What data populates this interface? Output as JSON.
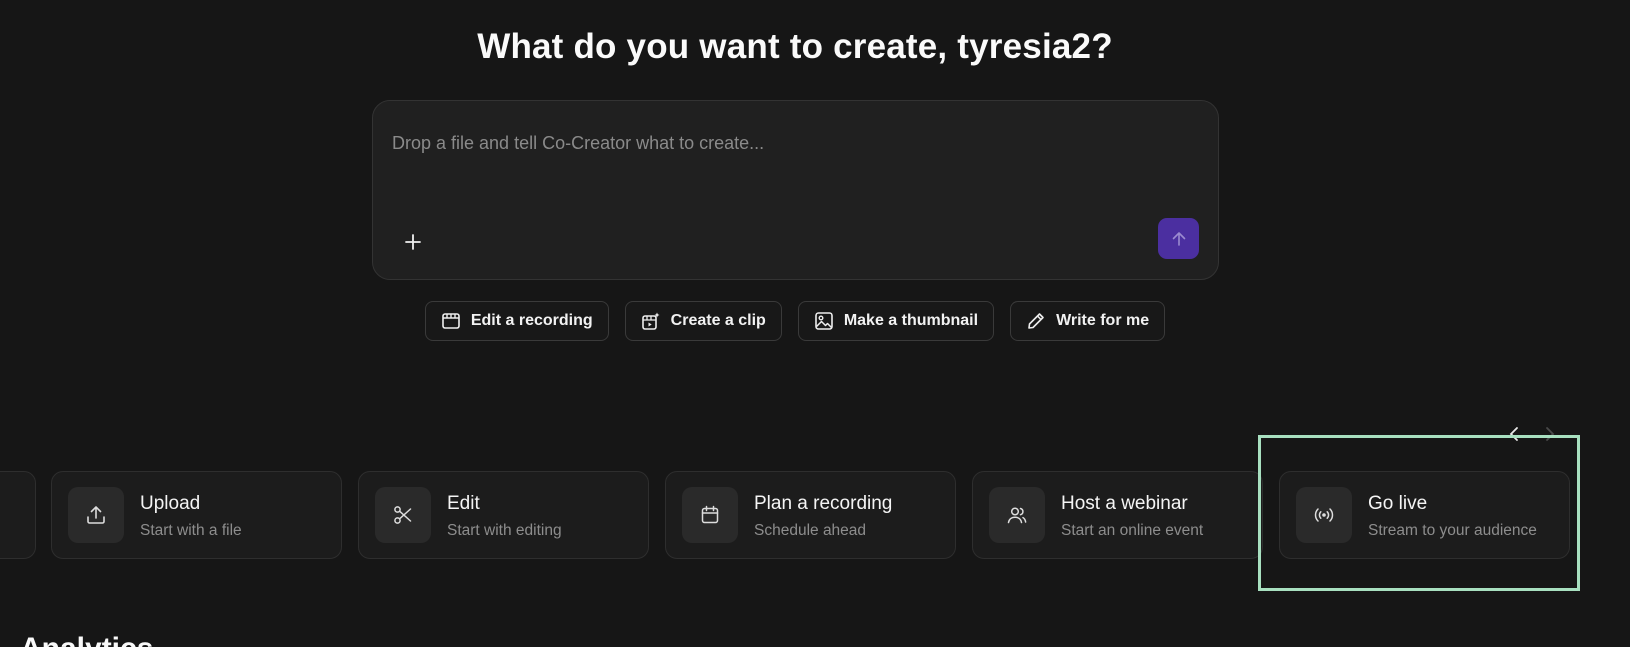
{
  "hero": {
    "title": "What do you want to create, tyresia2?"
  },
  "composer": {
    "placeholder": "Drop a file and tell Co-Creator what to create...",
    "value": ""
  },
  "quick_actions": [
    {
      "label": "Edit a recording",
      "icon": "video-frame-icon"
    },
    {
      "label": "Create a clip",
      "icon": "sparkle-clip-icon"
    },
    {
      "label": "Make a thumbnail",
      "icon": "image-icon"
    },
    {
      "label": "Write for me",
      "icon": "pencil-icon"
    }
  ],
  "cards": [
    {
      "title": "Upload",
      "subtitle": "Start with a file",
      "icon": "upload-icon"
    },
    {
      "title": "Edit",
      "subtitle": "Start with editing",
      "icon": "scissors-icon"
    },
    {
      "title": "Plan a recording",
      "subtitle": "Schedule ahead",
      "icon": "calendar-icon"
    },
    {
      "title": "Host a webinar",
      "subtitle": "Start an online event",
      "icon": "users-icon"
    },
    {
      "title": "Go live",
      "subtitle": "Stream to your audience",
      "icon": "broadcast-icon"
    }
  ],
  "section_peek": {
    "title": "Analytics"
  },
  "colors": {
    "background": "#161616",
    "send_button": "#4b2fa0",
    "highlight": "#a8e0c0"
  }
}
